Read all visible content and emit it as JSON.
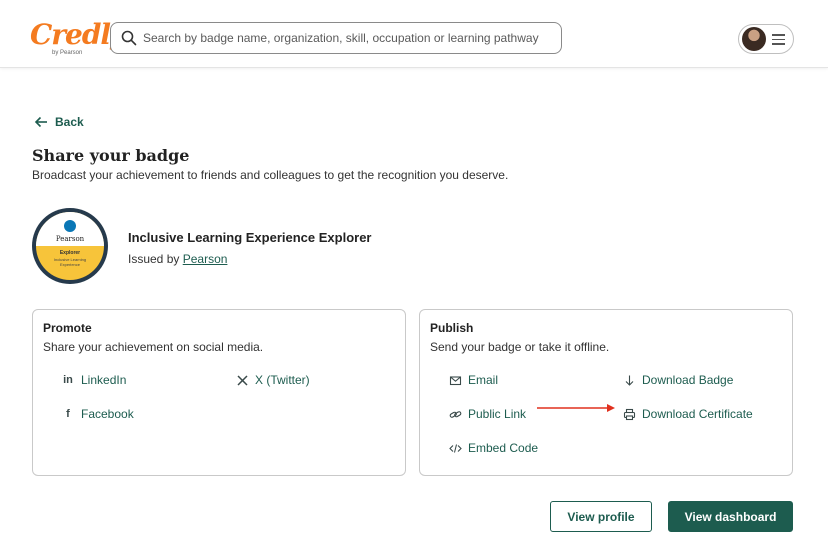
{
  "brand": {
    "logo_text": "Credly",
    "logo_subtext": "by Pearson",
    "accent_color": "#f47b20",
    "primary_color": "#1d5c4f"
  },
  "search": {
    "placeholder": "Search by badge name, organization, skill, occupation or learning pathway",
    "value": ""
  },
  "nav": {
    "back_label": "Back"
  },
  "page": {
    "title": "Share your badge",
    "subtitle": "Broadcast your achievement to friends and colleagues to get the recognition you deserve."
  },
  "badge": {
    "name": "Inclusive Learning Experience Explorer",
    "issued_by_prefix": "Issued by",
    "issuer": "Pearson",
    "image_issuer": "Pearson",
    "image_level": "Explorer",
    "image_title": "Inclusive Learning Experience"
  },
  "promote": {
    "title": "Promote",
    "description": "Share your achievement on social media.",
    "options": [
      {
        "label": "LinkedIn",
        "icon": "linkedin-icon"
      },
      {
        "label": "X (Twitter)",
        "icon": "x-icon"
      },
      {
        "label": "Facebook",
        "icon": "facebook-icon"
      }
    ]
  },
  "publish": {
    "title": "Publish",
    "description": "Send your badge or take it offline.",
    "options": [
      {
        "label": "Email",
        "icon": "email-icon"
      },
      {
        "label": "Download Badge",
        "icon": "download-icon"
      },
      {
        "label": "Public Link",
        "icon": "link-icon"
      },
      {
        "label": "Download Certificate",
        "icon": "printer-icon"
      },
      {
        "label": "Embed Code",
        "icon": "code-icon"
      }
    ]
  },
  "annotation": {
    "arrow_color": "#e0301e"
  },
  "actions": {
    "view_profile": "View profile",
    "view_dashboard": "View dashboard"
  }
}
